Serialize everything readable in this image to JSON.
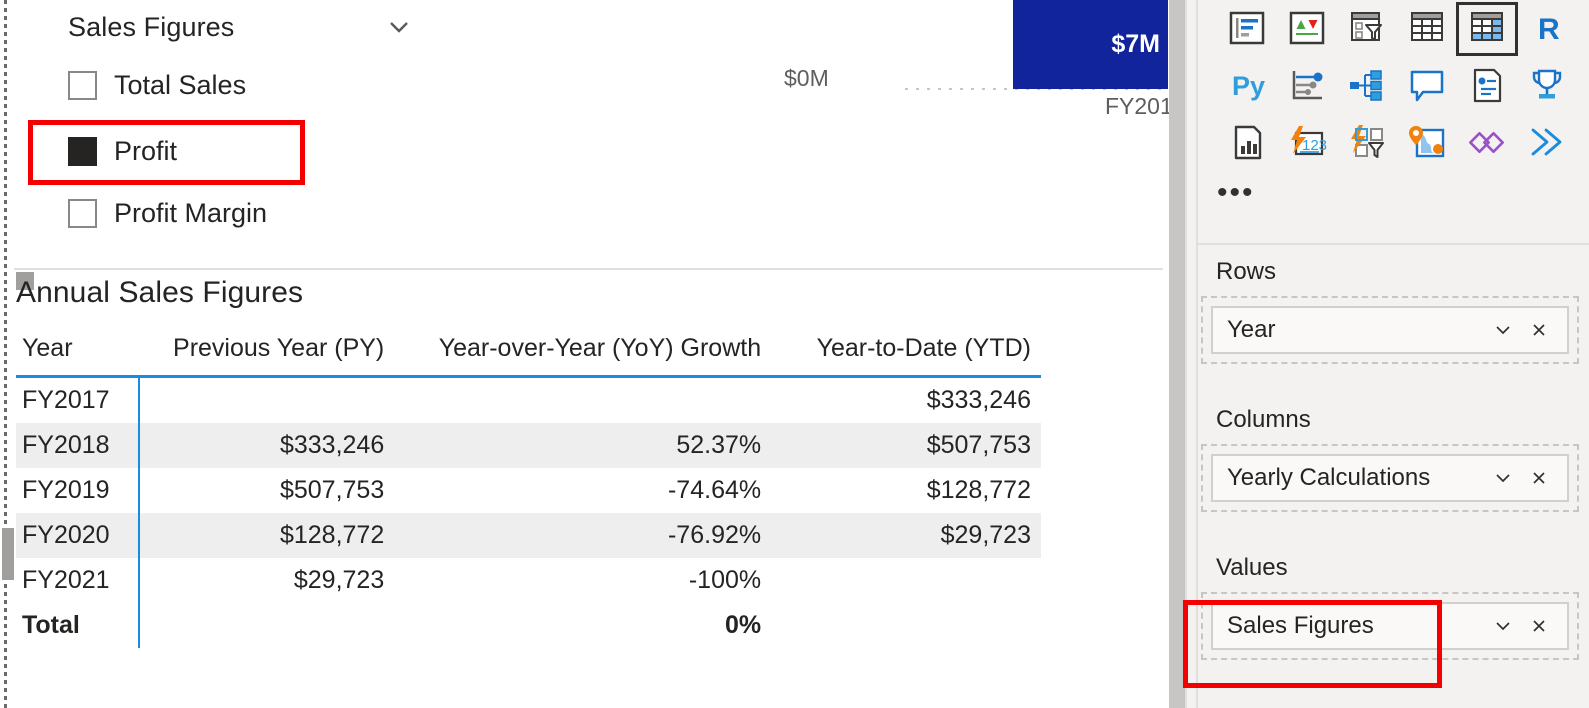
{
  "slicer": {
    "title": "Sales Figures",
    "chevron_icon": "chevron-down-icon",
    "items": [
      {
        "label": "Total Sales",
        "checked": false
      },
      {
        "label": "Profit",
        "checked": true
      },
      {
        "label": "Profit Margin",
        "checked": false
      }
    ]
  },
  "annotations": {
    "color": "#f40000",
    "targets": [
      "Profit",
      "Sales Figures"
    ]
  },
  "chart_data": {
    "type": "bar",
    "title": "",
    "categories": [
      "FY201"
    ],
    "values": [
      7
    ],
    "data_labels": [
      "$7M"
    ],
    "xlabel": "",
    "ylabel": "",
    "axis_tick_labels": [
      "$0M"
    ],
    "ylim": [
      0,
      7
    ],
    "grid": true,
    "series_color": "#11249b",
    "note": "partially visible clipped bar visual"
  },
  "matrix": {
    "title": "Annual Sales Figures",
    "columns": [
      "Year",
      "Previous Year (PY)",
      "Year-over-Year (YoY) Growth",
      "Year-to-Date (YTD)"
    ],
    "rows": [
      {
        "year": "FY2017",
        "py": "",
        "yoy": "",
        "ytd": "$333,246"
      },
      {
        "year": "FY2018",
        "py": "$333,246",
        "yoy": "52.37%",
        "ytd": "$507,753"
      },
      {
        "year": "FY2019",
        "py": "$507,753",
        "yoy": "-74.64%",
        "ytd": "$128,772"
      },
      {
        "year": "FY2020",
        "py": "$128,772",
        "yoy": "-76.92%",
        "ytd": "$29,723"
      },
      {
        "year": "FY2021",
        "py": "$29,723",
        "yoy": "-100%",
        "ytd": ""
      },
      {
        "year": "Total",
        "py": "",
        "yoy": "0%",
        "ytd": ""
      }
    ]
  },
  "visualizations_pane": {
    "gallery": {
      "rows": [
        [
          {
            "icon": "key-influencers-icon",
            "selected": false
          },
          {
            "icon": "kpi-arrows-icon",
            "selected": false
          },
          {
            "icon": "slicer-filter-icon",
            "selected": false
          },
          {
            "icon": "table-icon",
            "selected": false
          },
          {
            "icon": "matrix-icon",
            "selected": true
          },
          {
            "icon": "r-script-visual-icon",
            "selected": false
          }
        ],
        [
          {
            "icon": "python-visual-icon",
            "selected": false
          },
          {
            "icon": "key-influencers-dot-icon",
            "selected": false
          },
          {
            "icon": "decomposition-tree-icon",
            "selected": false
          },
          {
            "icon": "smart-narrative-icon",
            "selected": false
          },
          {
            "icon": "paginated-report-icon",
            "selected": false
          },
          {
            "icon": "goal-trophy-icon",
            "selected": false
          }
        ],
        [
          {
            "icon": "report-page-chart-icon",
            "selected": false
          },
          {
            "icon": "power-apps-number-icon",
            "selected": false
          },
          {
            "icon": "power-apps-filter-icon",
            "selected": false
          },
          {
            "icon": "arcgis-map-icon",
            "selected": false
          },
          {
            "icon": "power-automate-purple-icon",
            "selected": false
          },
          {
            "icon": "power-automate-blue-icon",
            "selected": false
          }
        ]
      ],
      "more_label": "•••",
      "more_icon": "ellipsis-icon"
    },
    "wells": [
      {
        "title": "Rows",
        "chip": {
          "label": "Year",
          "menu_icon": "chevron-down-icon",
          "remove_icon": "close-icon"
        }
      },
      {
        "title": "Columns",
        "chip": {
          "label": "Yearly Calculations",
          "menu_icon": "chevron-down-icon",
          "remove_icon": "close-icon"
        }
      },
      {
        "title": "Values",
        "chip": {
          "label": "Sales Figures",
          "menu_icon": "chevron-down-icon",
          "remove_icon": "close-icon"
        }
      }
    ]
  }
}
